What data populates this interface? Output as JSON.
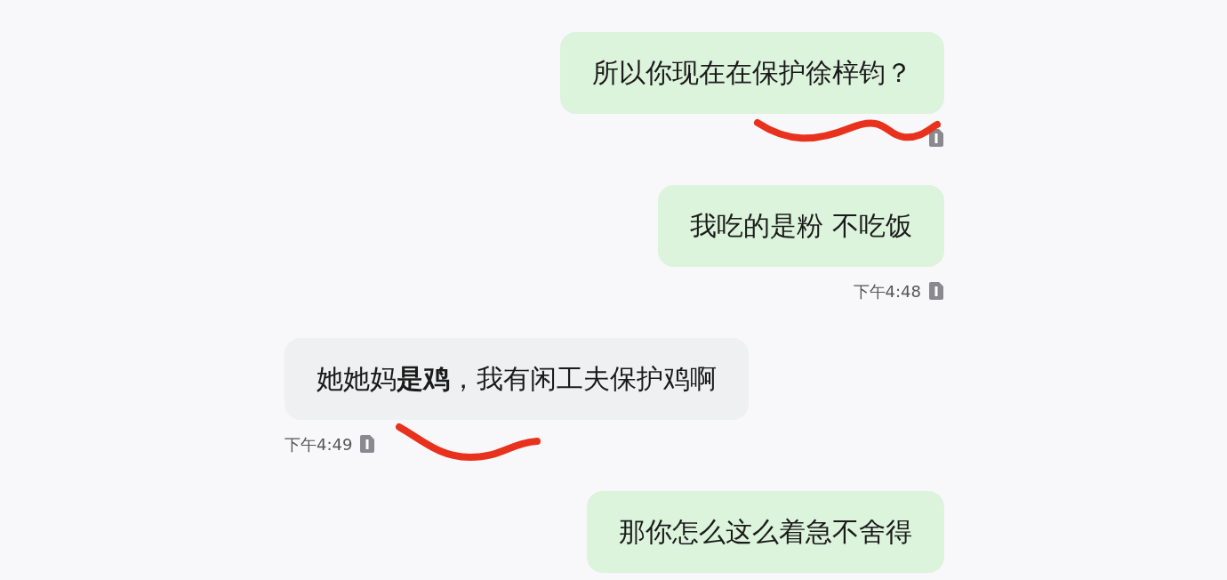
{
  "messages": [
    {
      "kind": "outgoing",
      "text": "所以你现在在保护徐梓钧？",
      "annotated": true
    },
    {
      "kind": "outgoing",
      "text": "我吃的是粉 不吃饭",
      "time": "下午4:48",
      "annotated": false
    },
    {
      "kind": "incoming",
      "text": "她她妈**是鸡**，我有闲工夫保护鸡啊",
      "time": "下午4:49",
      "annotated": true
    },
    {
      "kind": "outgoing",
      "text": "那你怎么这么着急不舍得",
      "annotated": false
    }
  ]
}
